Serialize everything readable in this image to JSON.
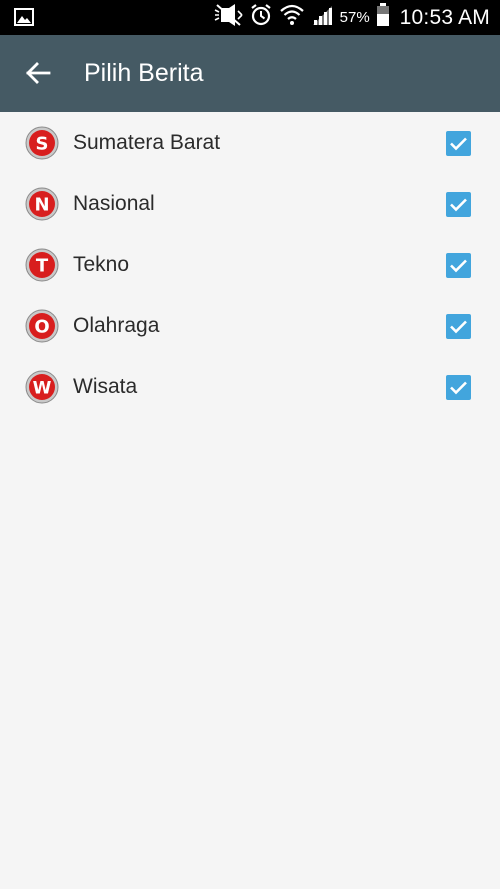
{
  "status_bar": {
    "left_icon": "gallery-icon",
    "icons": [
      "mute-icon",
      "alarm-icon",
      "wifi-icon",
      "signal-icon"
    ],
    "battery_percent": "57%",
    "battery_level": 0.57,
    "time": "10:53 AM"
  },
  "app_bar": {
    "back_icon": "arrow-back-icon",
    "title": "Pilih Berita",
    "background": "#455a64"
  },
  "items": [
    {
      "letter": "S",
      "label": "Sumatera Barat",
      "checked": true
    },
    {
      "letter": "N",
      "label": "Nasional",
      "checked": true
    },
    {
      "letter": "T",
      "label": "Tekno",
      "checked": true
    },
    {
      "letter": "O",
      "label": "Olahraga",
      "checked": true
    },
    {
      "letter": "W",
      "label": "Wisata",
      "checked": true
    }
  ],
  "colors": {
    "logo_red": "#d81e1e",
    "checkbox_blue": "#42a5dd",
    "page_background": "#f5f5f5"
  }
}
